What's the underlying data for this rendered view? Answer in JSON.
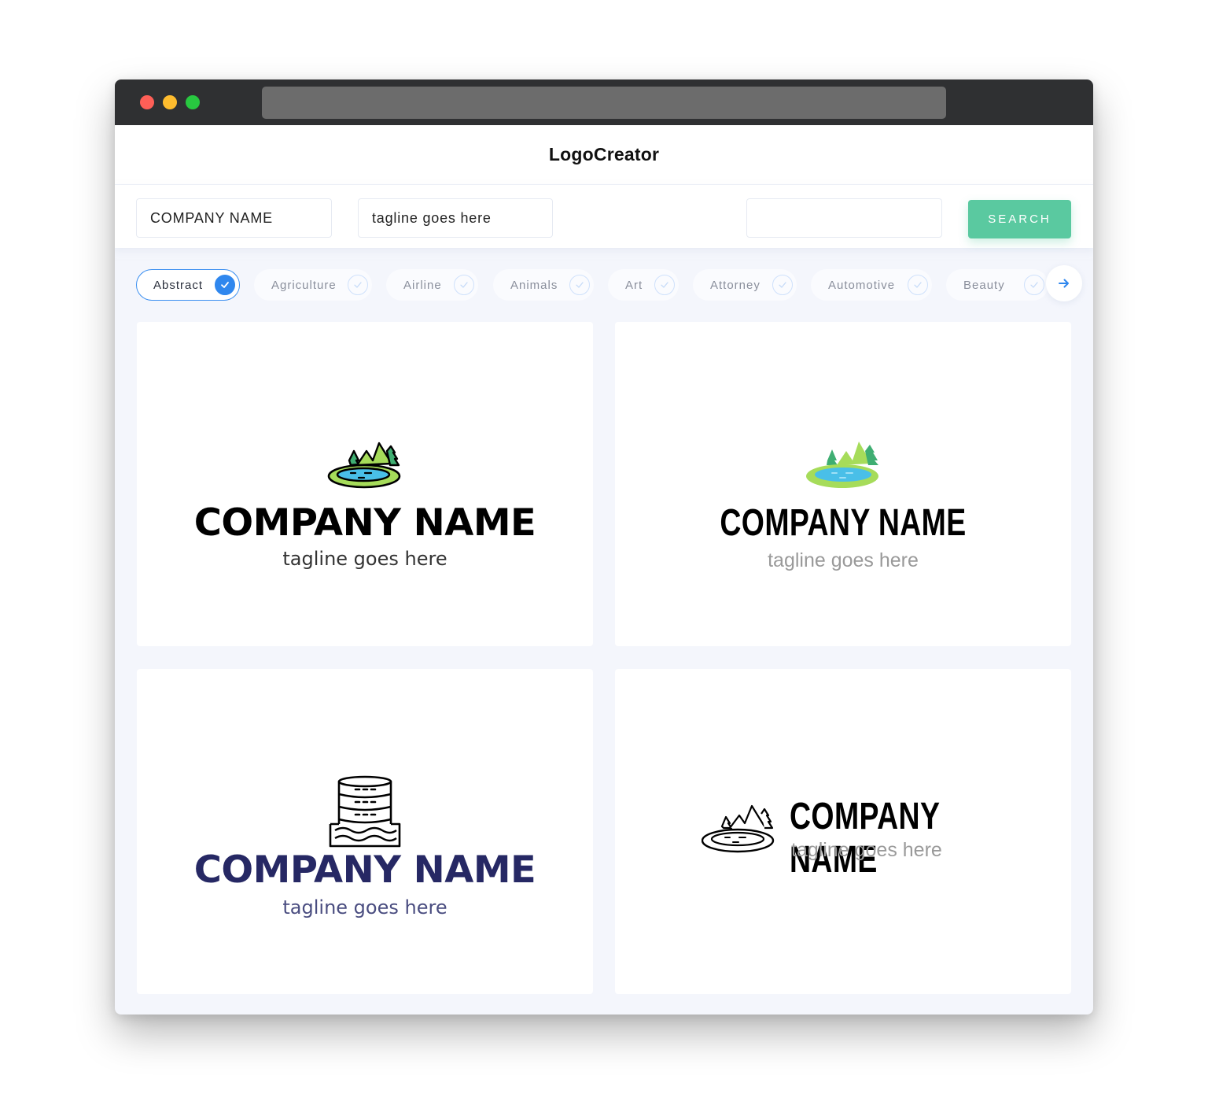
{
  "window": {
    "title": "LogoCreator"
  },
  "search": {
    "company_value": "COMPANY NAME",
    "tagline_value": "tagline goes here",
    "extra_value": "",
    "button_label": "SEARCH"
  },
  "categories": [
    {
      "label": "Abstract",
      "selected": true
    },
    {
      "label": "Agriculture",
      "selected": false
    },
    {
      "label": "Airline",
      "selected": false
    },
    {
      "label": "Animals",
      "selected": false
    },
    {
      "label": "Art",
      "selected": false
    },
    {
      "label": "Attorney",
      "selected": false
    },
    {
      "label": "Automotive",
      "selected": false
    },
    {
      "label": "Beauty",
      "selected": false
    }
  ],
  "next_icon": "arrow-right-icon",
  "logos": [
    {
      "company": "COMPANY NAME",
      "tagline": "tagline goes here",
      "icon": "lake-forest-color-outline-icon",
      "text_color": "#000000",
      "tagline_color": "#333333"
    },
    {
      "company": "COMPANY NAME",
      "tagline": "tagline goes here",
      "icon": "lake-forest-flat-icon",
      "text_color": "#000000",
      "tagline_color": "#9a9a9a"
    },
    {
      "company": "COMPANY NAME",
      "tagline": "tagline goes here",
      "icon": "water-tank-line-icon",
      "text_color": "#262864",
      "tagline_color": "#4a4d80"
    },
    {
      "company": "COMPANY NAME",
      "tagline": "tagline goes here",
      "icon": "lake-forest-line-icon",
      "text_color": "#000000",
      "tagline_color": "#9a9a9a"
    }
  ],
  "colors": {
    "accent": "#2f87ee",
    "search_button": "#5ac9a0",
    "titlebar": "#2f3032"
  }
}
